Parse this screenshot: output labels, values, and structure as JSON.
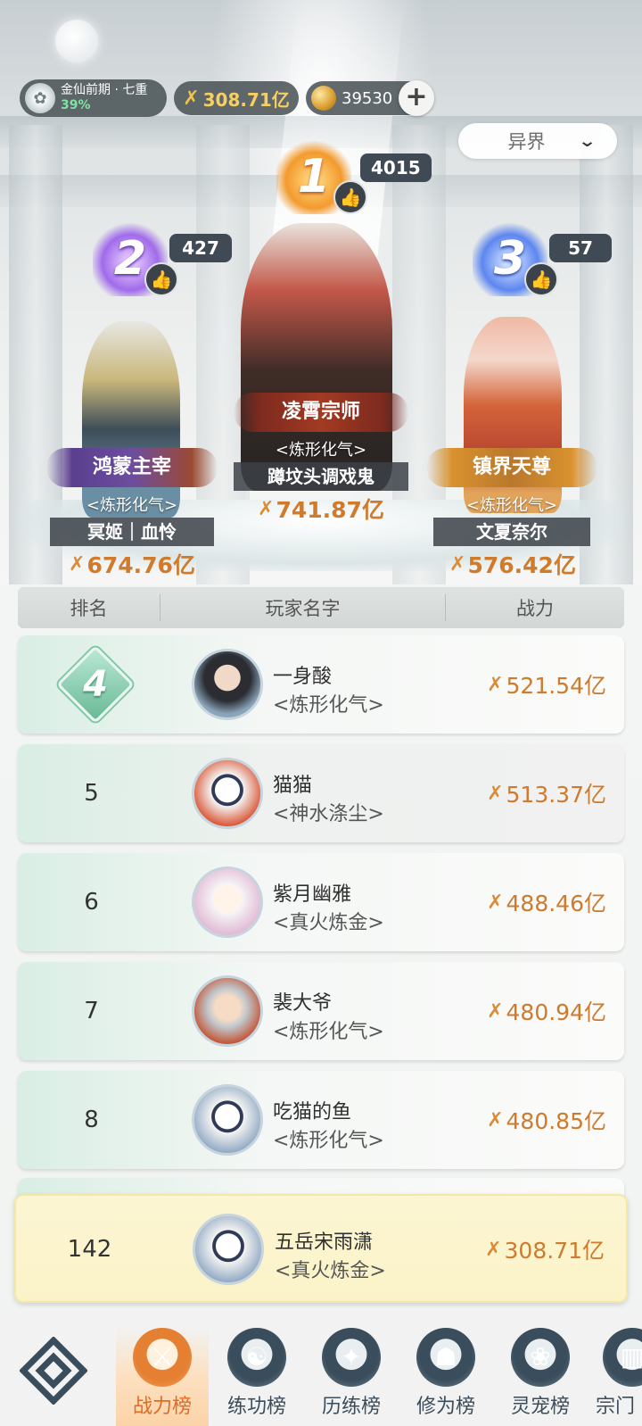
{
  "header": {
    "realm_label": "金仙前期 · 七重",
    "realm_progress": "39%",
    "power_value": "308.71亿",
    "currency_value": "39530",
    "plus_glyph": "+",
    "realm_filter": "异界",
    "chevron_glyph": "⌄"
  },
  "podium": [
    {
      "rank": "1",
      "likes": "4015",
      "title": "凌霄宗师",
      "sect": "<炼形化气>",
      "name": "蹲坟头调戏鬼",
      "power": "741.87亿",
      "color": "#f39a2d"
    },
    {
      "rank": "2",
      "likes": "427",
      "title": "鸿蒙主宰",
      "sect": "<炼形化气>",
      "name": "冥姬｜血怜",
      "power": "674.76亿",
      "color": "#a06bea"
    },
    {
      "rank": "3",
      "likes": "57",
      "title": "镇界天尊",
      "sect": "<炼形化气>",
      "name": "文夏奈尔",
      "power": "576.42亿",
      "color": "#5d86ef"
    }
  ],
  "table": {
    "headers": {
      "rank": "排名",
      "name": "玩家名字",
      "power": "战力"
    },
    "rows": [
      {
        "rank": "4",
        "name": "一身酸",
        "sect": "<炼形化气>",
        "power": "521.54亿"
      },
      {
        "rank": "5",
        "name": "猫猫",
        "sect": "<神水涤尘>",
        "power": "513.37亿"
      },
      {
        "rank": "6",
        "name": "紫月幽雅",
        "sect": "<真火炼金>",
        "power": "488.46亿"
      },
      {
        "rank": "7",
        "name": "裴大爷",
        "sect": "<炼形化气>",
        "power": "480.94亿"
      },
      {
        "rank": "8",
        "name": "吃猫的鱼",
        "sect": "<炼形化气>",
        "power": "480.85亿"
      }
    ],
    "self": {
      "rank": "142",
      "name": "五岳宋雨潇",
      "sect": "<真火炼金>",
      "power": "308.71亿"
    }
  },
  "bottom_nav": [
    {
      "label": "战力榜",
      "icon": "crossed-swords-icon",
      "active": true
    },
    {
      "label": "练功榜",
      "icon": "yin-yang-icon",
      "active": false
    },
    {
      "label": "历练榜",
      "icon": "planet-star-icon",
      "active": false
    },
    {
      "label": "修为榜",
      "icon": "meditation-hat-icon",
      "active": false
    },
    {
      "label": "灵宠榜",
      "icon": "spirit-cat-icon",
      "active": false
    },
    {
      "label": "宗门",
      "icon": "sect-gate-icon",
      "active": false
    }
  ],
  "glyphs": {
    "sword": "✗",
    "thumb": "👍"
  },
  "colors": {
    "accent_orange": "#e06b25",
    "power_text": "#cf7a2c",
    "gold": "#f6cf62",
    "progress_green": "#7fe2a6"
  }
}
